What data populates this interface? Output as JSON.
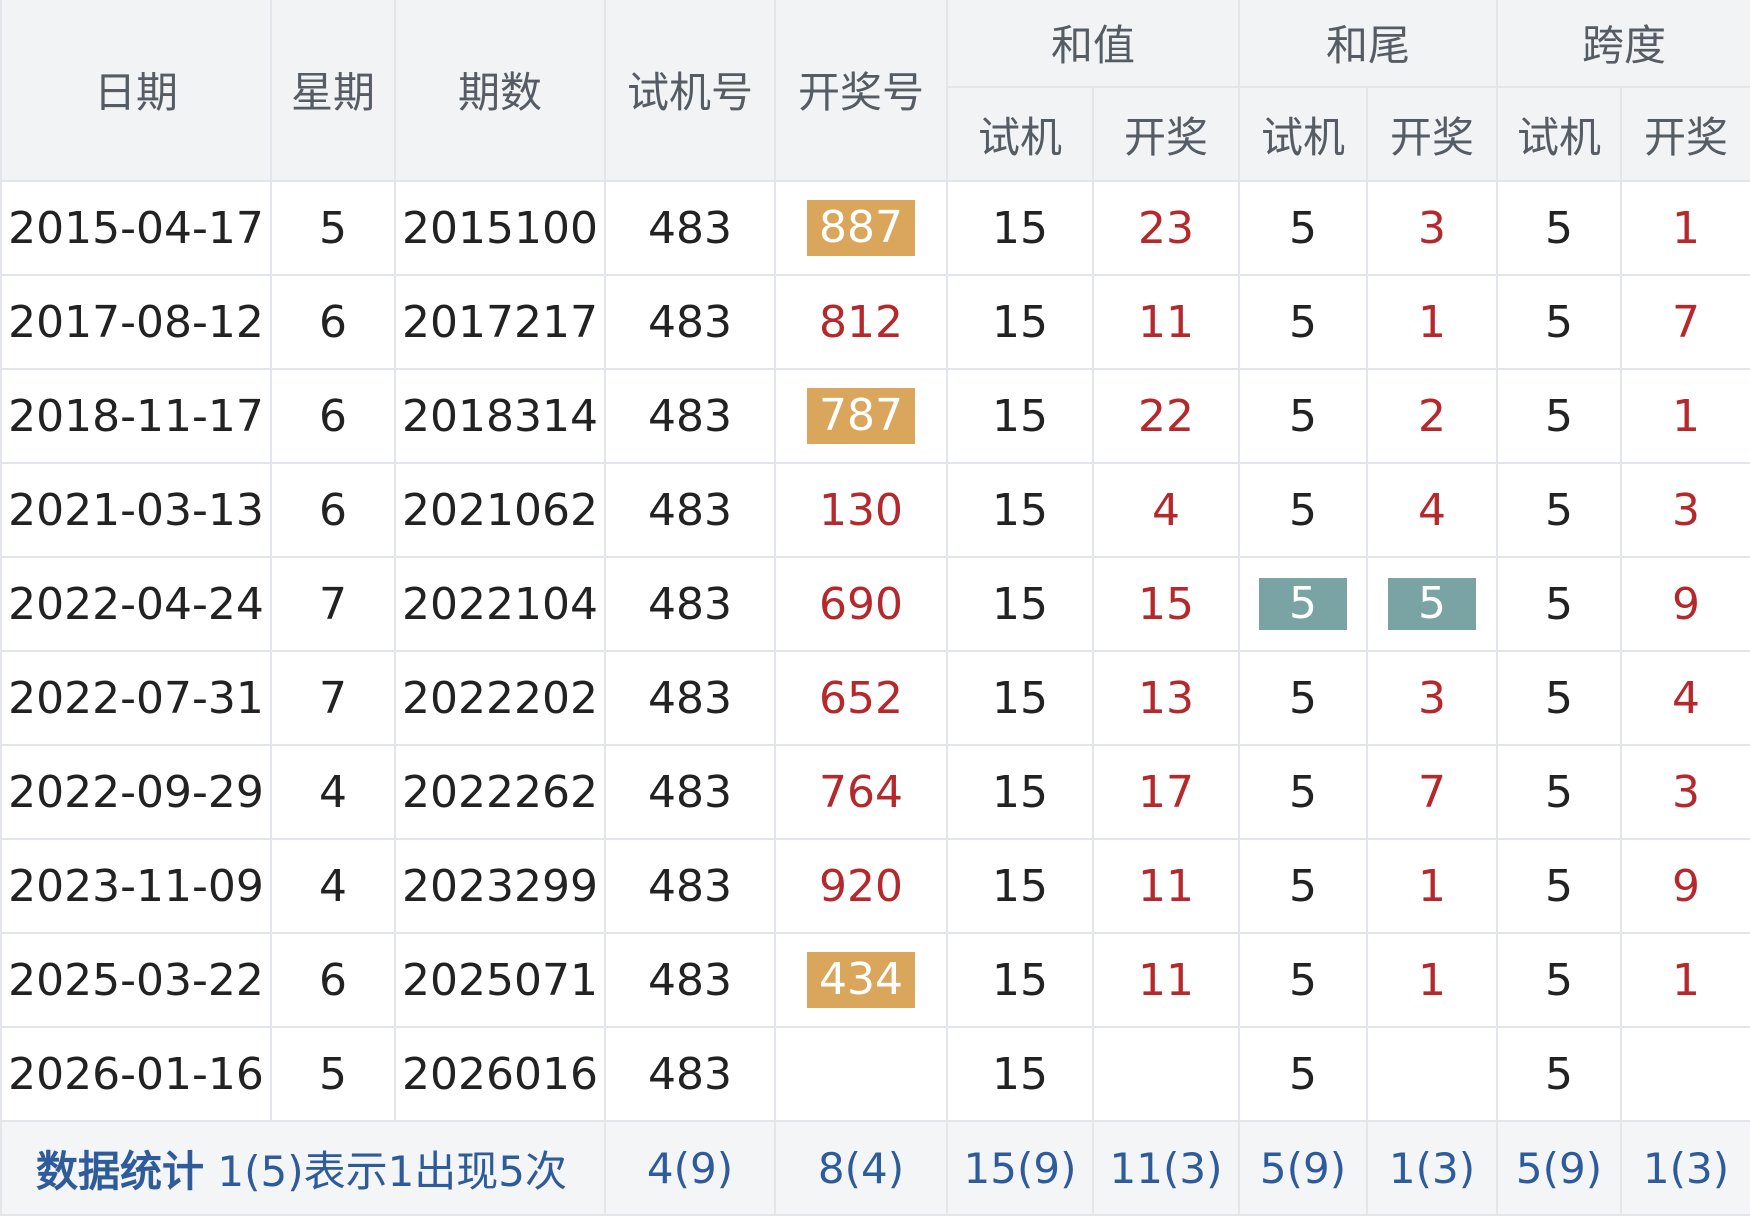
{
  "header": {
    "date": "日期",
    "weekday": "星期",
    "issue": "期数",
    "test_number": "试机号",
    "draw_number": "开奖号",
    "sum_group": "和值",
    "tail_group": "和尾",
    "span_group": "跨度",
    "sub_test": "试机",
    "sub_draw": "开奖"
  },
  "rows": [
    {
      "date": "2015-04-17",
      "weekday": "5",
      "issue": "2015100",
      "test": "483",
      "draw": "887",
      "sum_test": "15",
      "sum_draw": "23",
      "tail_test": "5",
      "tail_draw": "3",
      "span_test": "5",
      "span_draw": "1"
    },
    {
      "date": "2017-08-12",
      "weekday": "6",
      "issue": "2017217",
      "test": "483",
      "draw": "812",
      "sum_test": "15",
      "sum_draw": "11",
      "tail_test": "5",
      "tail_draw": "1",
      "span_test": "5",
      "span_draw": "7"
    },
    {
      "date": "2018-11-17",
      "weekday": "6",
      "issue": "2018314",
      "test": "483",
      "draw": "787",
      "sum_test": "15",
      "sum_draw": "22",
      "tail_test": "5",
      "tail_draw": "2",
      "span_test": "5",
      "span_draw": "1"
    },
    {
      "date": "2021-03-13",
      "weekday": "6",
      "issue": "2021062",
      "test": "483",
      "draw": "130",
      "sum_test": "15",
      "sum_draw": "4",
      "tail_test": "5",
      "tail_draw": "4",
      "span_test": "5",
      "span_draw": "3"
    },
    {
      "date": "2022-04-24",
      "weekday": "7",
      "issue": "2022104",
      "test": "483",
      "draw": "690",
      "sum_test": "15",
      "sum_draw": "15",
      "tail_test": "5",
      "tail_draw": "5",
      "span_test": "5",
      "span_draw": "9"
    },
    {
      "date": "2022-07-31",
      "weekday": "7",
      "issue": "2022202",
      "test": "483",
      "draw": "652",
      "sum_test": "15",
      "sum_draw": "13",
      "tail_test": "5",
      "tail_draw": "3",
      "span_test": "5",
      "span_draw": "4"
    },
    {
      "date": "2022-09-29",
      "weekday": "4",
      "issue": "2022262",
      "test": "483",
      "draw": "764",
      "sum_test": "15",
      "sum_draw": "17",
      "tail_test": "5",
      "tail_draw": "7",
      "span_test": "5",
      "span_draw": "3"
    },
    {
      "date": "2023-11-09",
      "weekday": "4",
      "issue": "2023299",
      "test": "483",
      "draw": "920",
      "sum_test": "15",
      "sum_draw": "11",
      "tail_test": "5",
      "tail_draw": "1",
      "span_test": "5",
      "span_draw": "9"
    },
    {
      "date": "2025-03-22",
      "weekday": "6",
      "issue": "2025071",
      "test": "483",
      "draw": "434",
      "sum_test": "15",
      "sum_draw": "11",
      "tail_test": "5",
      "tail_draw": "1",
      "span_test": "5",
      "span_draw": "1"
    },
    {
      "date": "2026-01-16",
      "weekday": "5",
      "issue": "2026016",
      "test": "483",
      "draw": "",
      "sum_test": "15",
      "sum_draw": "",
      "tail_test": "5",
      "tail_draw": "",
      "span_test": "5",
      "span_draw": ""
    }
  ],
  "stats": {
    "title": "数据统计",
    "note": "1(5)表示1出现5次",
    "test": "4(9)",
    "draw": "8(4)",
    "sum_test": "15(9)",
    "sum_draw": "11(3)",
    "tail_test": "5(9)",
    "tail_draw": "1(3)",
    "span_test": "5(9)",
    "span_draw": "1(3)"
  },
  "colors": {
    "header_bg": "#f2f3f5",
    "header_text": "#555c63",
    "draw_red": "#b5292c",
    "highlight_orange": "#d9a65c",
    "highlight_teal": "#7aa3a3",
    "stats_blue": "#2e5b9a"
  }
}
